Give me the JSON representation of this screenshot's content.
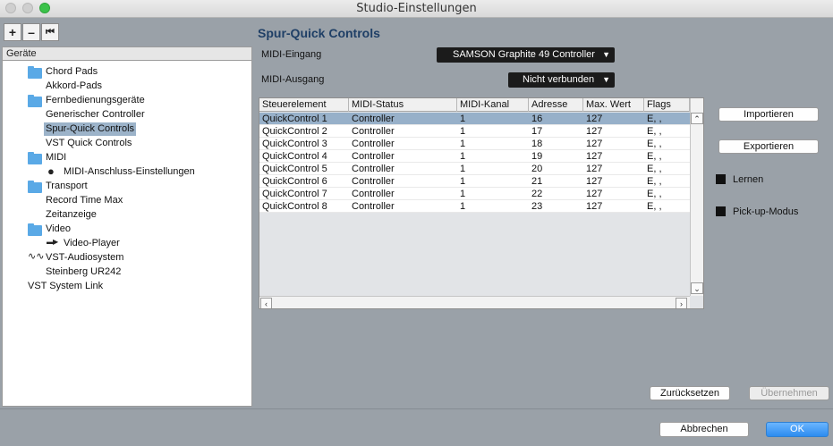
{
  "window": {
    "title": "Studio-Einstellungen"
  },
  "toolbar": {
    "add_label": "+",
    "remove_label": "–",
    "reset_label": "⏮"
  },
  "tree": {
    "header": "Geräte",
    "items": [
      {
        "label": "Chord Pads",
        "icon": "folder-icon"
      },
      {
        "label": "Akkord-Pads"
      },
      {
        "label": "Fernbedienungsgeräte",
        "icon": "folder-icon"
      },
      {
        "label": "Generischer Controller"
      },
      {
        "label": "Spur-Quick Controls",
        "selected": true
      },
      {
        "label": "VST Quick Controls"
      },
      {
        "label": "MIDI",
        "icon": "folder-icon"
      },
      {
        "label": "MIDI-Anschluss-Einstellungen",
        "icon": "midi-port-icon"
      },
      {
        "label": "Transport",
        "icon": "folder-icon"
      },
      {
        "label": "Record Time Max"
      },
      {
        "label": "Zeitanzeige"
      },
      {
        "label": "Video",
        "icon": "folder-icon"
      },
      {
        "label": "Video-Player",
        "icon": "video-icon"
      },
      {
        "label": "VST-Audiosystem",
        "icon": "audio-wave-icon"
      },
      {
        "label": "Steinberg UR242"
      },
      {
        "label": "VST System Link"
      }
    ]
  },
  "panel": {
    "title": "Spur-Quick Controls",
    "midi_input_label": "MIDI-Eingang",
    "midi_input_value": "SAMSON Graphite 49 Controller",
    "midi_output_label": "MIDI-Ausgang",
    "midi_output_value": "Nicht verbunden"
  },
  "table": {
    "columns": [
      "Steuerelement",
      "MIDI-Status",
      "MIDI-Kanal",
      "Adresse",
      "Max. Wert",
      "Flags"
    ],
    "rows": [
      [
        "QuickControl 1",
        "Controller",
        "1",
        "16",
        "127",
        "E, ,"
      ],
      [
        "QuickControl 2",
        "Controller",
        "1",
        "17",
        "127",
        "E, ,"
      ],
      [
        "QuickControl 3",
        "Controller",
        "1",
        "18",
        "127",
        "E, ,"
      ],
      [
        "QuickControl 4",
        "Controller",
        "1",
        "19",
        "127",
        "E, ,"
      ],
      [
        "QuickControl 5",
        "Controller",
        "1",
        "20",
        "127",
        "E, ,"
      ],
      [
        "QuickControl 6",
        "Controller",
        "1",
        "21",
        "127",
        "E, ,"
      ],
      [
        "QuickControl 7",
        "Controller",
        "1",
        "22",
        "127",
        "E, ,"
      ],
      [
        "QuickControl 8",
        "Controller",
        "1",
        "23",
        "127",
        "E, ,"
      ]
    ],
    "selected_row": 0
  },
  "side_buttons": {
    "import_label": "Importieren",
    "export_label": "Exportieren",
    "learn_label": "Lernen",
    "pickup_label": "Pick-up-Modus"
  },
  "footer": {
    "reset_label": "Zurücksetzen",
    "apply_label": "Übernehmen",
    "cancel_label": "Abbrechen",
    "ok_label": "OK"
  }
}
